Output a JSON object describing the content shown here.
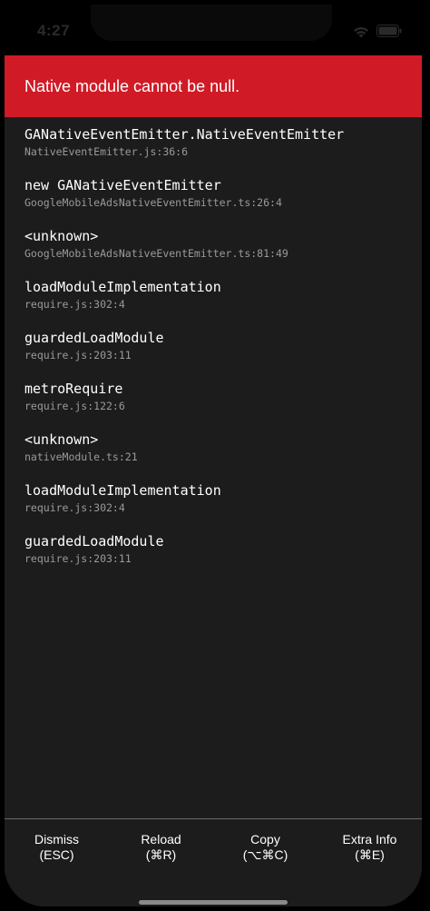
{
  "status_bar": {
    "time": "4:27",
    "wifi_icon": "wifi-icon",
    "battery_icon": "battery-icon"
  },
  "error": {
    "title": "Native module cannot be null."
  },
  "stack": [
    {
      "method": "GANativeEventEmitter.NativeEventEmitter",
      "location": "NativeEventEmitter.js:36:6"
    },
    {
      "method": "new GANativeEventEmitter",
      "location": "GoogleMobileAdsNativeEventEmitter.ts:26:4"
    },
    {
      "method": "<unknown>",
      "location": "GoogleMobileAdsNativeEventEmitter.ts:81:49"
    },
    {
      "method": "loadModuleImplementation",
      "location": "require.js:302:4"
    },
    {
      "method": "guardedLoadModule",
      "location": "require.js:203:11"
    },
    {
      "method": "metroRequire",
      "location": "require.js:122:6"
    },
    {
      "method": "<unknown>",
      "location": "nativeModule.ts:21"
    },
    {
      "method": "loadModuleImplementation",
      "location": "require.js:302:4"
    },
    {
      "method": "guardedLoadModule",
      "location": "require.js:203:11"
    }
  ],
  "footer": {
    "dismiss": {
      "label": "Dismiss",
      "shortcut": "(ESC)"
    },
    "reload": {
      "label": "Reload",
      "shortcut": "(⌘R)"
    },
    "copy": {
      "label": "Copy",
      "shortcut": "(⌥⌘C)"
    },
    "extra_info": {
      "label": "Extra Info",
      "shortcut": "(⌘E)"
    }
  },
  "colors": {
    "banner": "#d01a26",
    "background": "#1c1c1c",
    "text": "#ffffff",
    "muted_text": "#9a9a9a"
  }
}
